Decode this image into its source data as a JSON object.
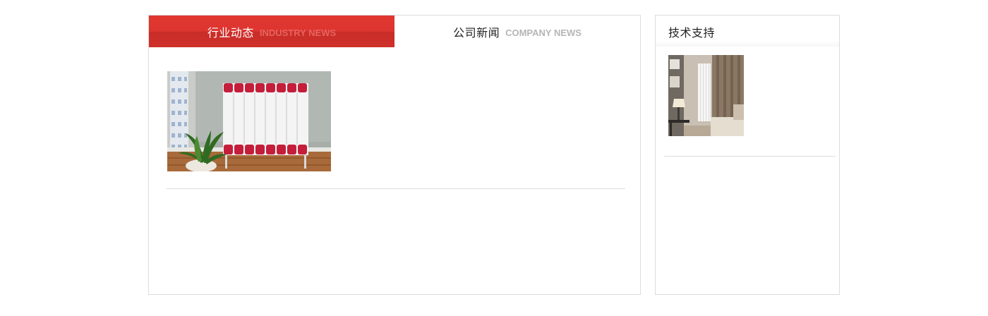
{
  "news_panel": {
    "tabs": [
      {
        "label_zh": "行业动态",
        "label_en": "INDUSTRY NEWS",
        "active": true
      },
      {
        "label_zh": "公司新闻",
        "label_en": "COMPANY NEWS",
        "active": false
      }
    ],
    "image": {
      "subject": "red and white radiator beside window with potted plant"
    }
  },
  "support_panel": {
    "title": "技术支持",
    "image": {
      "subject": "tall white vertical radiator in living room with curtains"
    }
  },
  "colors": {
    "accent_red": "#dd3530",
    "border": "#dcdcdc",
    "muted_text": "#b5b5b5"
  }
}
